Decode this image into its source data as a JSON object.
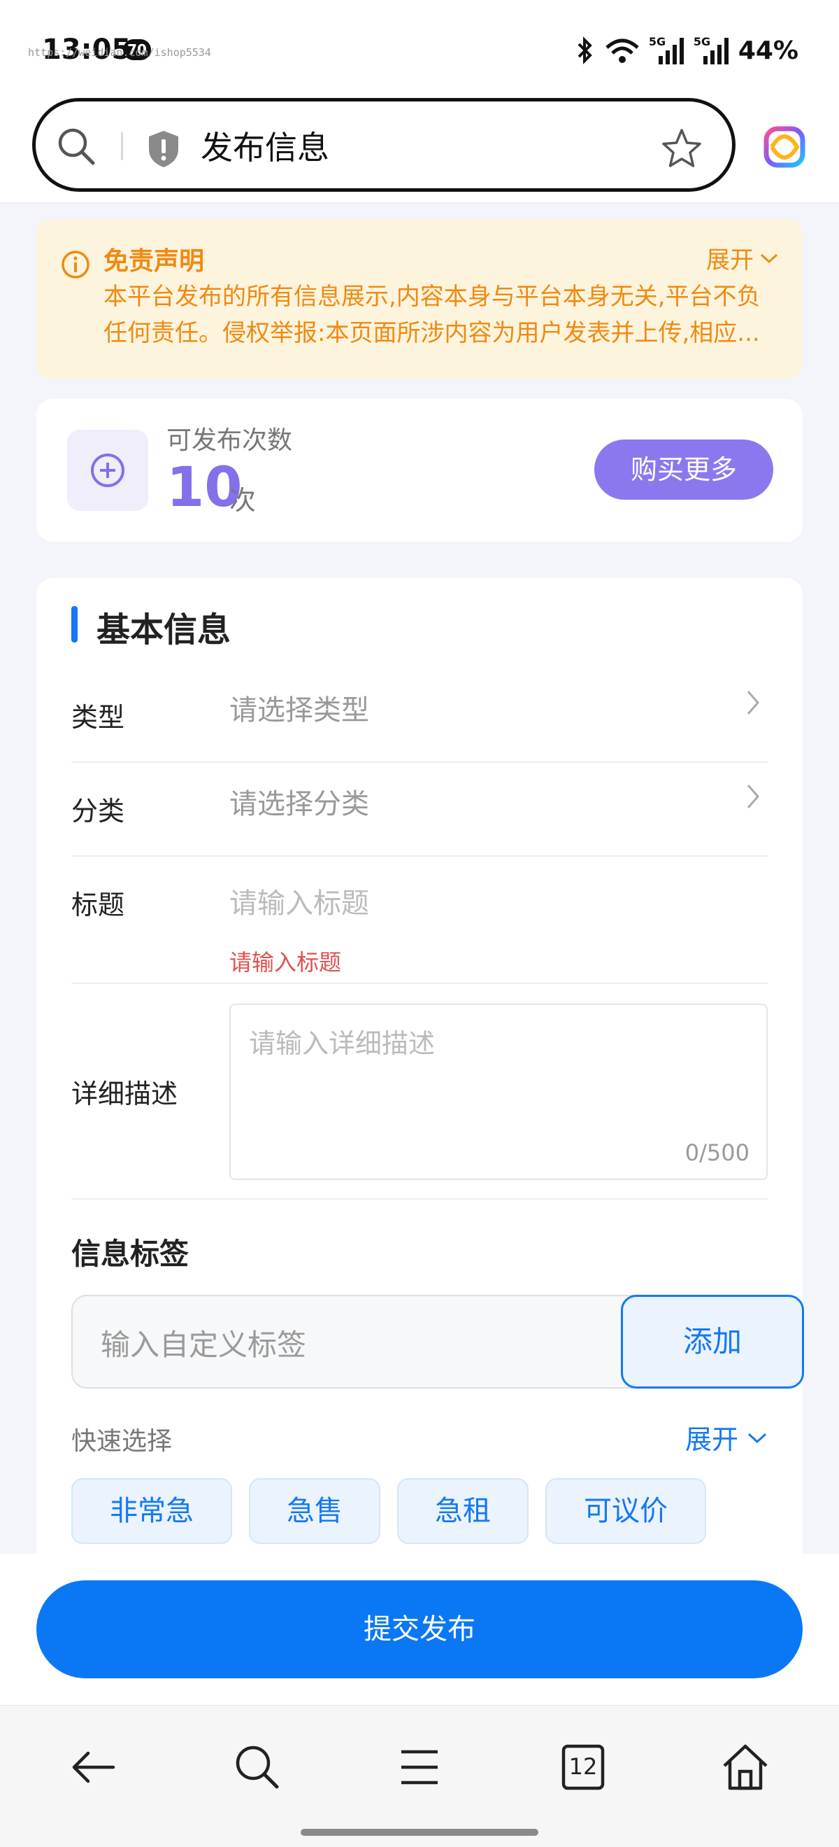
{
  "status_bar": {
    "time": "13:05",
    "notification_count": "70",
    "url_watermark": "https://weidian.com/ishop5534",
    "battery": "44%",
    "signal_1": "5G",
    "signal_2": "5G"
  },
  "header": {
    "title": "发布信息"
  },
  "disclaimer": {
    "title": "免责声明",
    "expand_label": "展开",
    "text": "本平台发布的所有信息展示,内容本身与平台本身无关,平台不负任何责任。侵权举报:本页面所涉内容为用户发表并上传,相应..."
  },
  "quota": {
    "label": "可发布次数",
    "count": "10",
    "unit": "次",
    "buy_label": "购买更多"
  },
  "form": {
    "section_title": "基本信息",
    "type": {
      "label": "类型",
      "placeholder": "请选择类型"
    },
    "category": {
      "label": "分类",
      "placeholder": "请选择分类"
    },
    "title": {
      "label": "标题",
      "placeholder": "请输入标题",
      "error": "请输入标题"
    },
    "description": {
      "label": "详细描述",
      "placeholder": "请输入详细描述",
      "counter": "0/500"
    },
    "tags": {
      "title": "信息标签",
      "input_placeholder": "输入自定义标签",
      "add_label": "添加",
      "quick_label": "快速选择",
      "expand_label": "展开",
      "chips": [
        "非常急",
        "急售",
        "急租",
        "可议价"
      ]
    }
  },
  "submit_label": "提交发布",
  "nav": {
    "tab_count": "12"
  },
  "colors": {
    "accent": "#0a78f5",
    "purple": "#8b78ef",
    "warning": "#ef8a13",
    "error": "#e05050"
  }
}
